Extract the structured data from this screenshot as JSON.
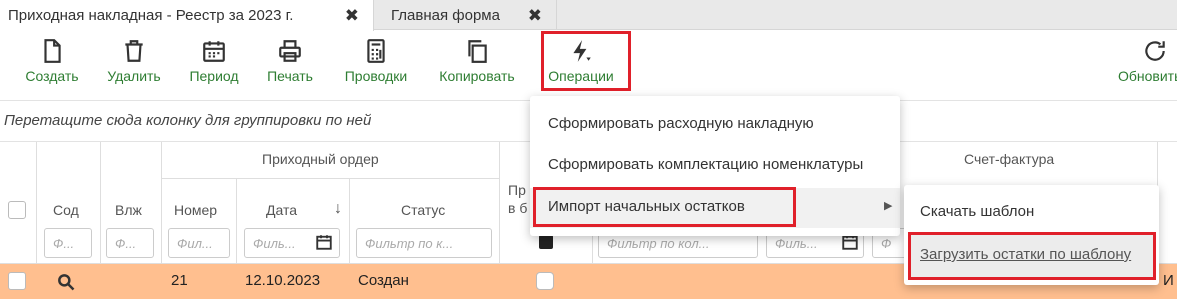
{
  "tabs": [
    {
      "label": "Приходная накладная - Реестр за 2023 г.",
      "close": "✖"
    },
    {
      "label": "Главная форма",
      "close": "✖"
    }
  ],
  "toolbar": {
    "items": [
      {
        "label": "Создать",
        "icon": "file-icon"
      },
      {
        "label": "Удалить",
        "icon": "trash-icon"
      },
      {
        "label": "Период",
        "icon": "calendar-icon"
      },
      {
        "label": "Печать",
        "icon": "printer-icon"
      },
      {
        "label": "Проводки",
        "icon": "calculator-icon"
      },
      {
        "label": "Копировать",
        "icon": "copy-icon"
      },
      {
        "label": "Операции",
        "icon": "lightning-icon"
      },
      {
        "label": "Обновить",
        "icon": "refresh-icon"
      }
    ],
    "label_color": "#2e7d32"
  },
  "group_panel": {
    "text": "Перетащите сюда колонку для группировки по ней"
  },
  "grid": {
    "group_headers": {
      "prihodny_order": "Приходный ордер",
      "schet_faktura": "Счет-фактура"
    },
    "columns": {
      "sod": "Сод",
      "vlzh": "Влж",
      "nomer": "Номер",
      "data": "Дата",
      "data_sort": "↓",
      "status": "Статус",
      "pr_line1": "Пр",
      "pr_line2": "в б"
    },
    "filters": {
      "sod": "Ф...",
      "vlzh": "Ф...",
      "nomer": "Фил...",
      "data": "Филь...",
      "status": "Фильтр по к...",
      "kol": "Фильтр по кол...",
      "f2": "Филь...",
      "f3": "Ф"
    },
    "row": {
      "nomer": "21",
      "data": "12.10.2023",
      "status": "Создан",
      "tail": "И"
    },
    "row_color": "#ffbf8f"
  },
  "operations_menu": {
    "items": [
      "Сформировать расходную накладную",
      "Сформировать комплектацию номенклатуры",
      "Импорт начальных остатков"
    ],
    "submenu_arrow": "▶"
  },
  "import_submenu": {
    "items": [
      "Скачать шаблон",
      "Загрузить остатки по шаблону"
    ]
  },
  "highlight_color": "#e0202a"
}
